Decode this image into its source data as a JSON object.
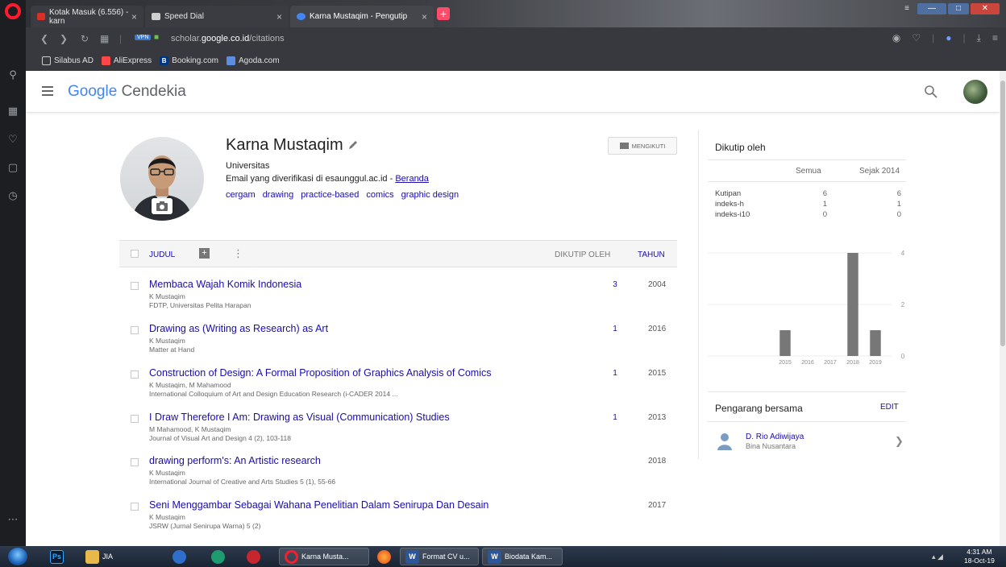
{
  "browser": {
    "tabs": [
      {
        "label": "Kotak Masuk (6.556) - karn"
      },
      {
        "label": "Speed Dial"
      },
      {
        "label": "Karna Mustaqim - Pengutip"
      }
    ],
    "tab_close": "×",
    "tab_add": "+",
    "address": {
      "url_prefix": "scholar.",
      "url_domain": "google.co.id",
      "url_path": "/citations",
      "vpn_label": "VPN"
    },
    "bookmarks": [
      {
        "label": "Silabus AD"
      },
      {
        "label": "AliExpress"
      },
      {
        "label": "Booking.com"
      },
      {
        "label": "Agoda.com"
      }
    ]
  },
  "header": {
    "logo_google": "Google",
    "logo_product": "Cendekia"
  },
  "profile": {
    "name": "Karna Mustaqim",
    "affiliation": "Universitas",
    "email_text": "Email yang diverifikasi di esaunggul.ac.id - ",
    "email_link": "Beranda",
    "interests": [
      "cergam",
      "drawing",
      "practice-based",
      "comics",
      "graphic design"
    ],
    "follow_label": "MENGIKUTI"
  },
  "table": {
    "col_title": "JUDUL",
    "col_cited": "DIKUTIP OLEH",
    "col_year": "TAHUN",
    "articles": [
      {
        "title": "Membaca Wajah Komik Indonesia",
        "authors": "K Mustaqim",
        "venue": "FDTP, Universitas Pelita Harapan",
        "cited": "3",
        "year": "2004"
      },
      {
        "title": "Drawing as (Writing as Research) as Art",
        "authors": "K Mustaqim",
        "venue": "Matter at Hand",
        "cited": "1",
        "year": "2016"
      },
      {
        "title": "Construction of Design: A Formal Proposition of Graphics Analysis of Comics",
        "authors": "K Mustaqim, M Mahamood",
        "venue": "International Colloquium of Art and Design Education Research (i-CADER 2014 ...",
        "cited": "1",
        "year": "2015"
      },
      {
        "title": "I Draw Therefore I Am: Drawing as Visual (Communication) Studies",
        "authors": "M Mahamood, K Mustaqim",
        "venue": "Journal of Visual Art and Design 4 (2), 103-118",
        "cited": "1",
        "year": "2013"
      },
      {
        "title": "drawing perform's: An Artistic research",
        "authors": "K Mustaqim",
        "venue": "International Journal of Creative and Arts Studies 5 (1), 55-66",
        "cited": "",
        "year": "2018"
      },
      {
        "title": "Seni Menggambar Sebagai Wahana Penelitian Dalam Senirupa Dan Desain",
        "authors": "K Mustaqim",
        "venue": "JSRW (Jurnal Senirupa Warna) 5 (2)",
        "cited": "",
        "year": "2017"
      }
    ]
  },
  "cited_by": {
    "title": "Dikutip oleh",
    "col_all": "Semua",
    "col_since": "Sejak 2014",
    "rows": [
      {
        "label": "Kutipan",
        "all": "6",
        "since": "6"
      },
      {
        "label": "indeks-h",
        "all": "1",
        "since": "1"
      },
      {
        "label": "indeks-i10",
        "all": "0",
        "since": "0"
      }
    ]
  },
  "chart_data": {
    "type": "bar",
    "categories": [
      "2015",
      "2016",
      "2017",
      "2018",
      "2019"
    ],
    "values": [
      1,
      0,
      0,
      4,
      1
    ],
    "ylim": [
      0,
      4
    ],
    "yticks": [
      "4",
      "2",
      "0"
    ],
    "bar_color": "#777777"
  },
  "coauthors": {
    "title": "Pengarang bersama",
    "edit_label": "EDIT",
    "items": [
      {
        "name": "D. Rio Adiwijaya",
        "affiliation": "Bina Nusantara"
      }
    ]
  },
  "taskbar": {
    "items": [
      {
        "label": "JIA"
      },
      {
        "label": "Karna Musta..."
      },
      {
        "label": "Format CV u..."
      },
      {
        "label": "Biodata Kam..."
      }
    ],
    "time": "4:31 AM",
    "date": "18-Oct-19"
  },
  "colors": {
    "link": "#1a0dab",
    "opera_red": "#ff1b2d"
  }
}
